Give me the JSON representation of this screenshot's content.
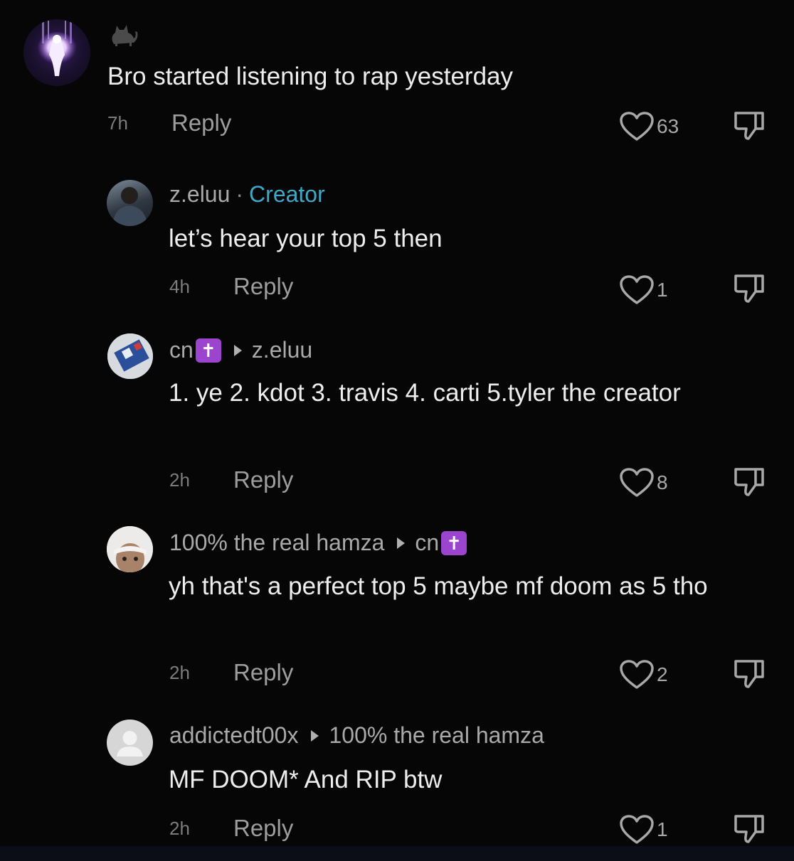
{
  "comments": [
    {
      "username": "",
      "text": "Bro started listening to rap yesterday",
      "time": "7h",
      "reply_label": "Reply",
      "likes": "63",
      "avatar_icon": "glowing-figure-avatar",
      "name_icon": "cat-icon"
    },
    {
      "username": "z.eluu",
      "separator": "·",
      "badge": "Creator",
      "text": "let’s hear your top 5 then",
      "time": "4h",
      "reply_label": "Reply",
      "likes": "1"
    },
    {
      "username": "cn",
      "badge_glyph": "✝",
      "reply_to": "z.eluu",
      "text": "1. ye 2. kdot 3. travis 4. carti 5.tyler the creator",
      "time": "2h",
      "reply_label": "Reply",
      "likes": "8"
    },
    {
      "username": "100% the real hamza",
      "reply_to": "cn",
      "reply_to_badge_glyph": "✝",
      "text": "yh that's a perfect top 5 maybe mf doom as 5 tho",
      "time": "2h",
      "reply_label": "Reply",
      "likes": "2"
    },
    {
      "username": "addictedt00x",
      "reply_to": "100% the real hamza",
      "text": "MF DOOM* And RIP btw",
      "time": "2h",
      "reply_label": "Reply",
      "likes": "1"
    }
  ],
  "colors": {
    "background": "#060606",
    "creator_badge": "#3fa7c8",
    "cross_badge": "#9b45cf"
  }
}
